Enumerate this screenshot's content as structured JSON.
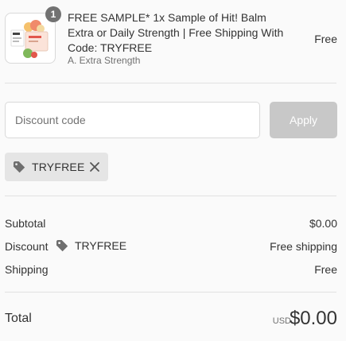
{
  "product": {
    "quantity": "1",
    "title": "FREE SAMPLE* 1x Sample of Hit! Balm Extra or Daily Strength | Free Shipping With Code: TRYFREE",
    "variant": "A. Extra Strength",
    "price": "Free"
  },
  "discount": {
    "placeholder": "Discount code",
    "apply_label": "Apply",
    "applied_code": "TRYFREE"
  },
  "summary": {
    "subtotal_label": "Subtotal",
    "subtotal_value": "$0.00",
    "discount_label": "Discount",
    "discount_code": "TRYFREE",
    "discount_value": "Free shipping",
    "shipping_label": "Shipping",
    "shipping_value": "Free"
  },
  "total": {
    "label": "Total",
    "currency": "USD",
    "value": "$0.00"
  },
  "icons": {
    "tag": "tag-icon",
    "remove": "close-icon"
  },
  "colors": {
    "badge": "#727272",
    "apply_disabled": "#c8c8c8",
    "chip_bg": "#e5e5e5",
    "text": "#333333",
    "muted": "#717171"
  }
}
